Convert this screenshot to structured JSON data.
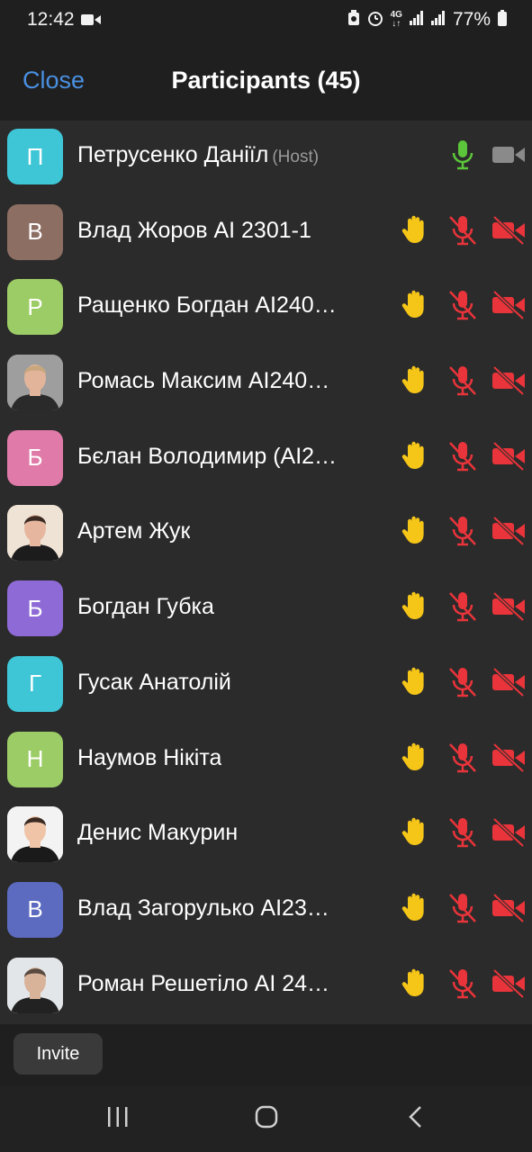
{
  "status_bar": {
    "time": "12:42",
    "network": "4G",
    "battery": "77%"
  },
  "header": {
    "close_label": "Close",
    "title": "Participants (45)"
  },
  "participants": [
    {
      "initial": "П",
      "name": "Петрусенко Даніїл",
      "tag": "(Host)",
      "color": "#3ec6d6",
      "photo": false,
      "hand": false,
      "mic": "on",
      "video": "off-gray"
    },
    {
      "initial": "В",
      "name": "Влад Жоров AI 2301-1",
      "tag": "",
      "color": "#8d6e63",
      "photo": false,
      "hand": true,
      "mic": "muted",
      "video": "off"
    },
    {
      "initial": "Р",
      "name": "Ращенко Богдан AI240…",
      "tag": "",
      "color": "#9ccc65",
      "photo": false,
      "hand": true,
      "mic": "muted",
      "video": "off"
    },
    {
      "initial": "",
      "name": "Ромась Максим AI240…",
      "tag": "",
      "color": "#9e9e9e",
      "photo": true,
      "hand": true,
      "mic": "muted",
      "video": "off"
    },
    {
      "initial": "Б",
      "name": "Бєлан Володимир (AI2…",
      "tag": "",
      "color": "#e07aa8",
      "photo": false,
      "hand": true,
      "mic": "muted",
      "video": "off"
    },
    {
      "initial": "",
      "name": "Артем Жук",
      "tag": "",
      "color": "#d8c2b0",
      "photo": true,
      "hand": true,
      "mic": "muted",
      "video": "off"
    },
    {
      "initial": "Б",
      "name": "Богдан Губка",
      "tag": "",
      "color": "#8e6ad6",
      "photo": false,
      "hand": true,
      "mic": "muted",
      "video": "off"
    },
    {
      "initial": "Г",
      "name": "Гусак Анатолій",
      "tag": "",
      "color": "#3ec6d6",
      "photo": false,
      "hand": true,
      "mic": "muted",
      "video": "off"
    },
    {
      "initial": "Н",
      "name": "Наумов Нікіта",
      "tag": "",
      "color": "#9ccc65",
      "photo": false,
      "hand": true,
      "mic": "muted",
      "video": "off"
    },
    {
      "initial": "",
      "name": "Денис Макурин",
      "tag": "",
      "color": "#e9e9e9",
      "photo": true,
      "hand": true,
      "mic": "muted",
      "video": "off"
    },
    {
      "initial": "В",
      "name": "Влад Загорулько AI23…",
      "tag": "",
      "color": "#5c6bc0",
      "photo": false,
      "hand": true,
      "mic": "muted",
      "video": "off"
    },
    {
      "initial": "",
      "name": "Роман Решетіло AI 24…",
      "tag": "",
      "color": "#cfd3d6",
      "photo": true,
      "hand": true,
      "mic": "muted",
      "video": "off"
    }
  ],
  "footer": {
    "invite_label": "Invite"
  },
  "icons": {
    "hand": "raised-hand-icon",
    "mic_on": "microphone-icon",
    "mic_muted": "microphone-muted-icon",
    "video_off": "video-off-icon",
    "video_inactive": "video-icon"
  },
  "colors": {
    "accent": "#4a90e2",
    "mic_on": "#5cc63a",
    "muted_red": "#e8343a",
    "hand_yellow": "#f5c518"
  }
}
